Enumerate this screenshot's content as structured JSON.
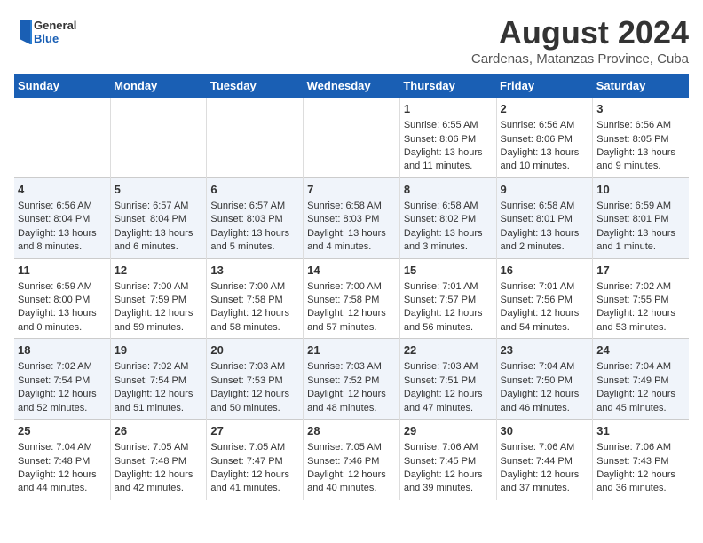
{
  "header": {
    "logo_general": "General",
    "logo_blue": "Blue",
    "month_year": "August 2024",
    "location": "Cardenas, Matanzas Province, Cuba"
  },
  "days_of_week": [
    "Sunday",
    "Monday",
    "Tuesday",
    "Wednesday",
    "Thursday",
    "Friday",
    "Saturday"
  ],
  "weeks": [
    [
      {
        "day": "",
        "info": ""
      },
      {
        "day": "",
        "info": ""
      },
      {
        "day": "",
        "info": ""
      },
      {
        "day": "",
        "info": ""
      },
      {
        "day": "1",
        "info": "Sunrise: 6:55 AM\nSunset: 8:06 PM\nDaylight: 13 hours\nand 11 minutes."
      },
      {
        "day": "2",
        "info": "Sunrise: 6:56 AM\nSunset: 8:06 PM\nDaylight: 13 hours\nand 10 minutes."
      },
      {
        "day": "3",
        "info": "Sunrise: 6:56 AM\nSunset: 8:05 PM\nDaylight: 13 hours\nand 9 minutes."
      }
    ],
    [
      {
        "day": "4",
        "info": "Sunrise: 6:56 AM\nSunset: 8:04 PM\nDaylight: 13 hours\nand 8 minutes."
      },
      {
        "day": "5",
        "info": "Sunrise: 6:57 AM\nSunset: 8:04 PM\nDaylight: 13 hours\nand 6 minutes."
      },
      {
        "day": "6",
        "info": "Sunrise: 6:57 AM\nSunset: 8:03 PM\nDaylight: 13 hours\nand 5 minutes."
      },
      {
        "day": "7",
        "info": "Sunrise: 6:58 AM\nSunset: 8:03 PM\nDaylight: 13 hours\nand 4 minutes."
      },
      {
        "day": "8",
        "info": "Sunrise: 6:58 AM\nSunset: 8:02 PM\nDaylight: 13 hours\nand 3 minutes."
      },
      {
        "day": "9",
        "info": "Sunrise: 6:58 AM\nSunset: 8:01 PM\nDaylight: 13 hours\nand 2 minutes."
      },
      {
        "day": "10",
        "info": "Sunrise: 6:59 AM\nSunset: 8:01 PM\nDaylight: 13 hours\nand 1 minute."
      }
    ],
    [
      {
        "day": "11",
        "info": "Sunrise: 6:59 AM\nSunset: 8:00 PM\nDaylight: 13 hours\nand 0 minutes."
      },
      {
        "day": "12",
        "info": "Sunrise: 7:00 AM\nSunset: 7:59 PM\nDaylight: 12 hours\nand 59 minutes."
      },
      {
        "day": "13",
        "info": "Sunrise: 7:00 AM\nSunset: 7:58 PM\nDaylight: 12 hours\nand 58 minutes."
      },
      {
        "day": "14",
        "info": "Sunrise: 7:00 AM\nSunset: 7:58 PM\nDaylight: 12 hours\nand 57 minutes."
      },
      {
        "day": "15",
        "info": "Sunrise: 7:01 AM\nSunset: 7:57 PM\nDaylight: 12 hours\nand 56 minutes."
      },
      {
        "day": "16",
        "info": "Sunrise: 7:01 AM\nSunset: 7:56 PM\nDaylight: 12 hours\nand 54 minutes."
      },
      {
        "day": "17",
        "info": "Sunrise: 7:02 AM\nSunset: 7:55 PM\nDaylight: 12 hours\nand 53 minutes."
      }
    ],
    [
      {
        "day": "18",
        "info": "Sunrise: 7:02 AM\nSunset: 7:54 PM\nDaylight: 12 hours\nand 52 minutes."
      },
      {
        "day": "19",
        "info": "Sunrise: 7:02 AM\nSunset: 7:54 PM\nDaylight: 12 hours\nand 51 minutes."
      },
      {
        "day": "20",
        "info": "Sunrise: 7:03 AM\nSunset: 7:53 PM\nDaylight: 12 hours\nand 50 minutes."
      },
      {
        "day": "21",
        "info": "Sunrise: 7:03 AM\nSunset: 7:52 PM\nDaylight: 12 hours\nand 48 minutes."
      },
      {
        "day": "22",
        "info": "Sunrise: 7:03 AM\nSunset: 7:51 PM\nDaylight: 12 hours\nand 47 minutes."
      },
      {
        "day": "23",
        "info": "Sunrise: 7:04 AM\nSunset: 7:50 PM\nDaylight: 12 hours\nand 46 minutes."
      },
      {
        "day": "24",
        "info": "Sunrise: 7:04 AM\nSunset: 7:49 PM\nDaylight: 12 hours\nand 45 minutes."
      }
    ],
    [
      {
        "day": "25",
        "info": "Sunrise: 7:04 AM\nSunset: 7:48 PM\nDaylight: 12 hours\nand 44 minutes."
      },
      {
        "day": "26",
        "info": "Sunrise: 7:05 AM\nSunset: 7:48 PM\nDaylight: 12 hours\nand 42 minutes."
      },
      {
        "day": "27",
        "info": "Sunrise: 7:05 AM\nSunset: 7:47 PM\nDaylight: 12 hours\nand 41 minutes."
      },
      {
        "day": "28",
        "info": "Sunrise: 7:05 AM\nSunset: 7:46 PM\nDaylight: 12 hours\nand 40 minutes."
      },
      {
        "day": "29",
        "info": "Sunrise: 7:06 AM\nSunset: 7:45 PM\nDaylight: 12 hours\nand 39 minutes."
      },
      {
        "day": "30",
        "info": "Sunrise: 7:06 AM\nSunset: 7:44 PM\nDaylight: 12 hours\nand 37 minutes."
      },
      {
        "day": "31",
        "info": "Sunrise: 7:06 AM\nSunset: 7:43 PM\nDaylight: 12 hours\nand 36 minutes."
      }
    ]
  ]
}
